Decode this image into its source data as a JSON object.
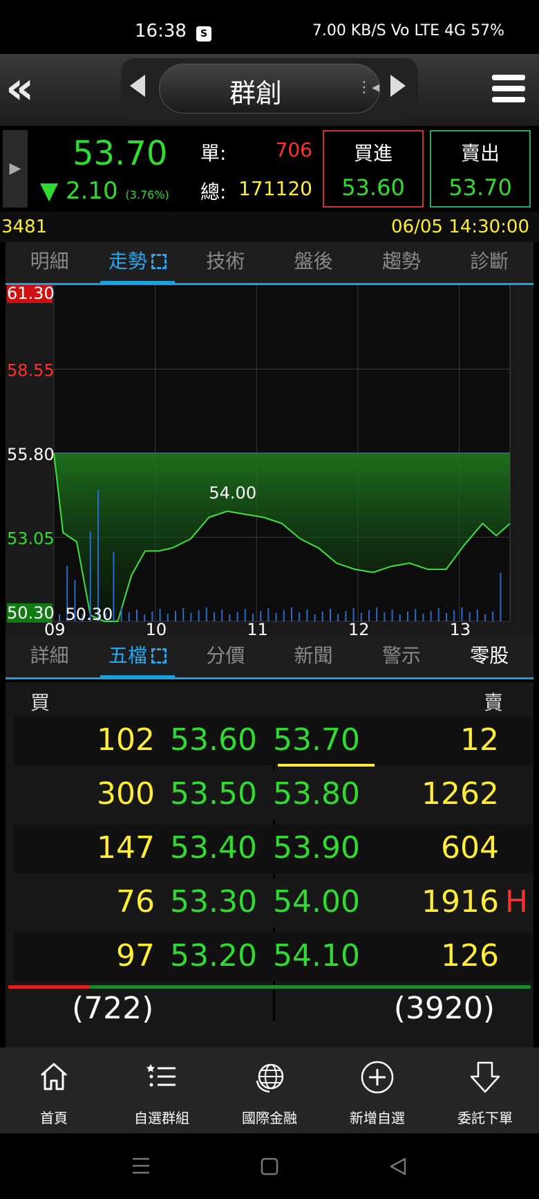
{
  "status": {
    "time": "16:38",
    "right": "7.00 KB/S  Vo LTE  4G  57%"
  },
  "header": {
    "stock_name": "群創"
  },
  "quote": {
    "price": "53.70",
    "change_arrow": "▼",
    "change": "2.10",
    "change_pct": "(3.76%)",
    "single_label": "單:",
    "single_value": "706",
    "total_label": "總:",
    "total_value": "171120",
    "buy_label": "買進",
    "buy_price": "53.60",
    "sell_label": "賣出",
    "sell_price": "53.70"
  },
  "info": {
    "code": "3481",
    "datetime": "06/05 14:30:00"
  },
  "tabs_top": [
    "明細",
    "走勢",
    "技術",
    "盤後",
    "趨勢",
    "診斷"
  ],
  "tabs_bottom": [
    "詳細",
    "五檔",
    "分價",
    "新聞",
    "警示",
    "零股"
  ],
  "chart_data": {
    "type": "line",
    "y_ticks": [
      "61.30",
      "58.55",
      "55.80",
      "53.05",
      "50.30"
    ],
    "ylim": [
      50.3,
      61.3
    ],
    "reference": 55.8,
    "x_ticks": [
      "09",
      "10",
      "11",
      "12",
      "13"
    ],
    "annotations": [
      {
        "text": "54.00",
        "value": 54.0
      },
      {
        "text": "50.30",
        "value": 50.3
      }
    ],
    "x": [
      0,
      0.02,
      0.05,
      0.08,
      0.11,
      0.14,
      0.17,
      0.2,
      0.23,
      0.26,
      0.3,
      0.34,
      0.38,
      0.42,
      0.46,
      0.5,
      0.54,
      0.58,
      0.62,
      0.66,
      0.7,
      0.74,
      0.78,
      0.82,
      0.86,
      0.9,
      0.94,
      0.97,
      1.0
    ],
    "values": [
      55.8,
      53.2,
      52.9,
      50.5,
      50.3,
      50.3,
      51.8,
      52.6,
      52.6,
      52.7,
      53.0,
      53.7,
      53.9,
      53.8,
      53.7,
      53.5,
      53.0,
      52.7,
      52.2,
      52.0,
      51.9,
      52.1,
      52.2,
      52.0,
      52.0,
      52.8,
      53.5,
      53.1,
      53.5
    ]
  },
  "book": {
    "buy_header": "買",
    "sell_header": "賣",
    "rows": [
      {
        "bid_qty": "102",
        "bid": "53.60",
        "ask": "53.70",
        "ask_qty": "12",
        "flag": ""
      },
      {
        "bid_qty": "300",
        "bid": "53.50",
        "ask": "53.80",
        "ask_qty": "1262",
        "flag": ""
      },
      {
        "bid_qty": "147",
        "bid": "53.40",
        "ask": "53.90",
        "ask_qty": "604",
        "flag": ""
      },
      {
        "bid_qty": "76",
        "bid": "53.30",
        "ask": "54.00",
        "ask_qty": "1916",
        "flag": "H"
      },
      {
        "bid_qty": "97",
        "bid": "53.20",
        "ask": "54.10",
        "ask_qty": "126",
        "flag": ""
      }
    ],
    "bid_total": "(722)",
    "ask_total": "(3920)",
    "buy_ratio": 0.156
  },
  "nav": [
    "首頁",
    "自選群組",
    "國際金融",
    "新增自選",
    "委託下單"
  ],
  "colors": {
    "up": "#ff3030",
    "down": "#2fdc2f",
    "qty": "#ffee33",
    "accent": "#1da0e0"
  }
}
